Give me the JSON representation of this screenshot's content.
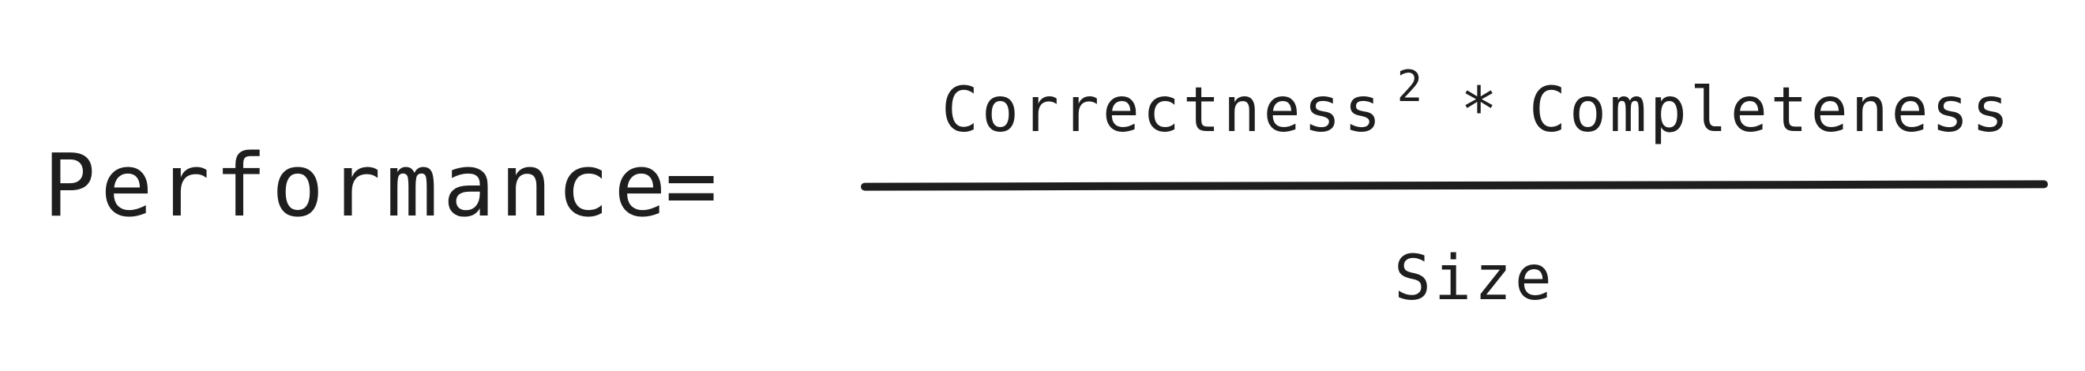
{
  "formula": {
    "lhs": "Performance",
    "equals": "=",
    "numerator": {
      "term1": "Correctness",
      "exponent": "2",
      "operator": "*",
      "term2": "Completeness"
    },
    "denominator": "Size"
  }
}
